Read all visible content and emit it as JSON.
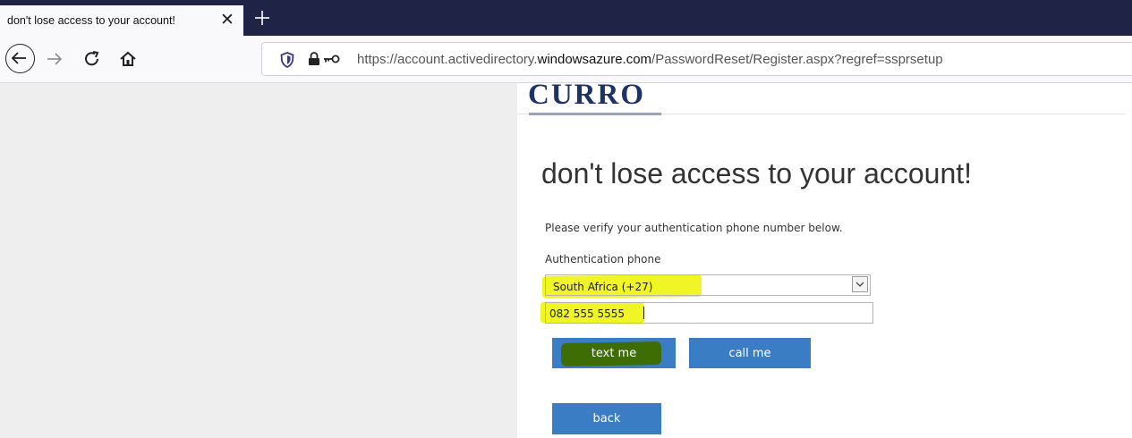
{
  "browser": {
    "tab_title": "don't lose access to your account!",
    "tab_close_glyph": "✕",
    "new_tab_icon": "plus-icon",
    "url_prefix": "https://account.activedirectory.",
    "url_domain": "windowsazure.com",
    "url_suffix": "/PasswordReset/Register.aspx?regref=ssprsetup",
    "nav_icons": [
      "back-arrow-icon",
      "forward-arrow-icon",
      "reload-icon",
      "home-icon",
      "shield-icon",
      "lock-icon",
      "key-icon"
    ]
  },
  "page": {
    "logo": "CURRO",
    "title": "don't lose access to your account!",
    "instructions": "Please verify your authentication phone number below.",
    "field_label": "Authentication phone",
    "country_select": {
      "selected": "South Africa (+27)"
    },
    "phone_input": {
      "value": "082 555 5555"
    },
    "buttons": {
      "text_me": "text me",
      "call_me": "call me",
      "back": "back"
    }
  },
  "colors": {
    "tabstrip": "#1f2446",
    "brand_navy": "#1c3363",
    "button_blue": "#3b7dc4",
    "highlight_yellow": "#f0f526",
    "highlight_green": "#3e6c05",
    "left_pane": "#eeeeee"
  }
}
